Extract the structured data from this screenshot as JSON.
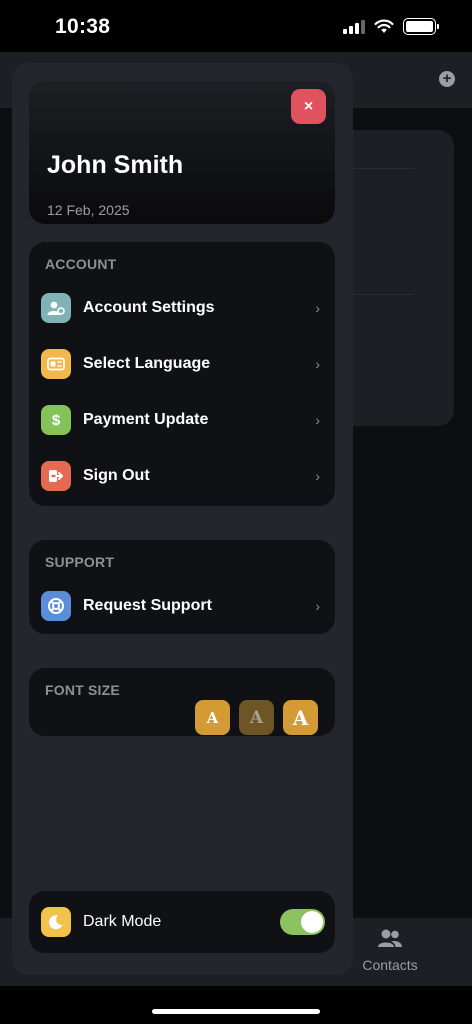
{
  "status_bar": {
    "time": "10:38"
  },
  "background_app": {
    "tabbar": {
      "contacts_label": "Contacts"
    }
  },
  "profile": {
    "name": "John Smith",
    "date": "12 Feb, 2025",
    "close_glyph": "×"
  },
  "account": {
    "title": "ACCOUNT",
    "items": [
      {
        "label": "Account Settings",
        "icon": "user-gear-icon",
        "color": "#7fb3b5",
        "glyph": "⚙"
      },
      {
        "label": "Select Language",
        "icon": "language-card-icon",
        "color": "#f2b84b",
        "glyph": "▤"
      },
      {
        "label": "Payment Update",
        "icon": "dollar-icon",
        "color": "#86c25a",
        "glyph": "$"
      },
      {
        "label": "Sign Out",
        "icon": "sign-out-icon",
        "color": "#e46a52",
        "glyph": "⇥"
      }
    ],
    "chevron": "›"
  },
  "support": {
    "title": "SUPPORT",
    "items": [
      {
        "label": "Request Support",
        "icon": "lifebuoy-icon",
        "color": "#5b8dd9",
        "glyph": "◎"
      }
    ]
  },
  "font_size": {
    "title": "FONT SIZE",
    "options": [
      {
        "glyph": "A",
        "color": "#d49a33"
      },
      {
        "glyph": "A",
        "color": "#6e5526"
      },
      {
        "glyph": "A",
        "color": "#d49a33"
      }
    ]
  },
  "dark_mode": {
    "label": "Dark Mode",
    "enabled": true,
    "icon_color": "#f2c34b",
    "toggle_color": "#8dc260"
  }
}
